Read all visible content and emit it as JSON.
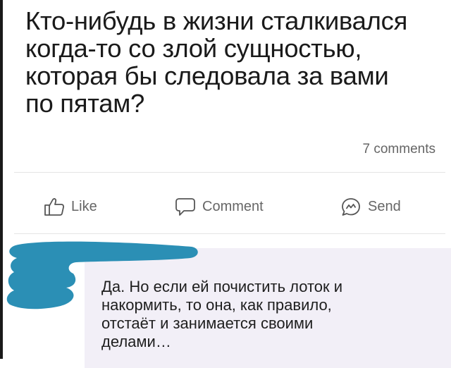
{
  "post": {
    "text": "Кто-нибудь в жизни сталкивался\nкогда-то со злой сущностью,\nкоторая бы следовала за вами\nпо пятам?",
    "comments_count": "7 comments"
  },
  "actions": {
    "like_label": "Like",
    "comment_label": "Comment",
    "send_label": "Send"
  },
  "reply": {
    "text": "Да. Но если ей почистить лоток и\nнакормить, то она, как правило,\nотстаёт и занимается своими\nделами…"
  },
  "colors": {
    "redaction": "#2b8fb5",
    "bubble": "#f2eff7",
    "action_gray": "#666666"
  }
}
